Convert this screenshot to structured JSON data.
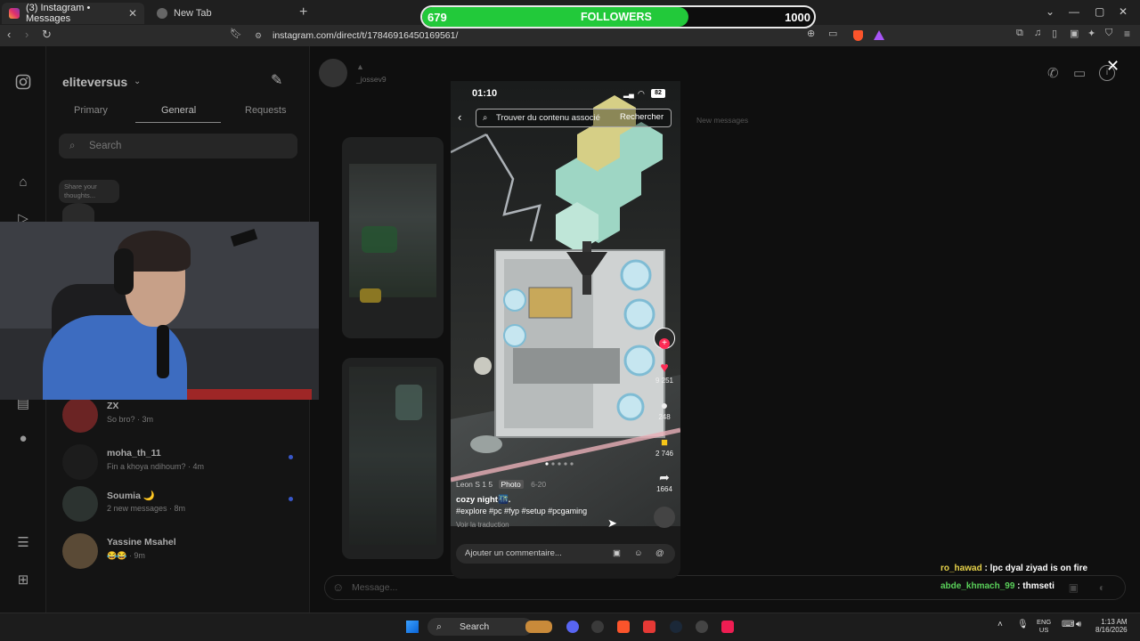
{
  "browser": {
    "tabs": [
      {
        "label": "(3) Instagram • Messages",
        "icon": "instagram-icon",
        "active": true
      },
      {
        "label": "New Tab",
        "icon": "brave-shield-icon",
        "active": false
      }
    ],
    "url": "instagram.com/direct/t/17846916450169561/"
  },
  "followers_goal": {
    "current": "679",
    "label": "FOLLOWERS",
    "target": "1000",
    "progress": 0.679,
    "color": "#22c93a"
  },
  "instagram": {
    "username": "eliteversus",
    "inbox_tabs": [
      "Primary",
      "General",
      "Requests"
    ],
    "active_tab": "General",
    "search_placeholder": "Search",
    "note_bubble": "Share your thoughts...",
    "conversations": [
      {
        "name": "ZX",
        "message": "So bro? · 3m"
      },
      {
        "name": "moha_th_11",
        "message": "Fin a khoya ndihoum? · 4m"
      },
      {
        "name": "Soumia 🌙",
        "message": "2 new messages · 8m"
      },
      {
        "name": "Yassine Msahel",
        "message": "😂😂 · 9m"
      }
    ],
    "chat_user": "_jossev9",
    "new_messages_label": "New messages",
    "message_placeholder": "Message..."
  },
  "phone": {
    "time": "01:10",
    "battery": "82",
    "search_placeholder": "Trouver du contenu associé",
    "search_button": "Rechercher",
    "likes": "9 251",
    "comments": "248",
    "saves": "2 746",
    "shares": "1664",
    "author": "Leon S 1 5",
    "post_type": "Photo",
    "date": "6-20",
    "caption": "cozy night🌃.",
    "hashtags": "#explore #pc #fyp #setup #pcgaming",
    "translate": "Voir la traduction",
    "comment_placeholder": "Ajouter un commentaire..."
  },
  "stream_chat": [
    {
      "user": "ro_hawad",
      "text": "lpc dyal ziyad is on fire",
      "color": "#e8d34a"
    },
    {
      "user": "abde_khmach_99",
      "text": "thmseti",
      "color": "#5ad15a"
    }
  ],
  "taskbar": {
    "search_label": "Search",
    "lang_top": "ENG",
    "lang_bottom": "US",
    "time": "1:13 AM",
    "date": "8/16/2026"
  }
}
